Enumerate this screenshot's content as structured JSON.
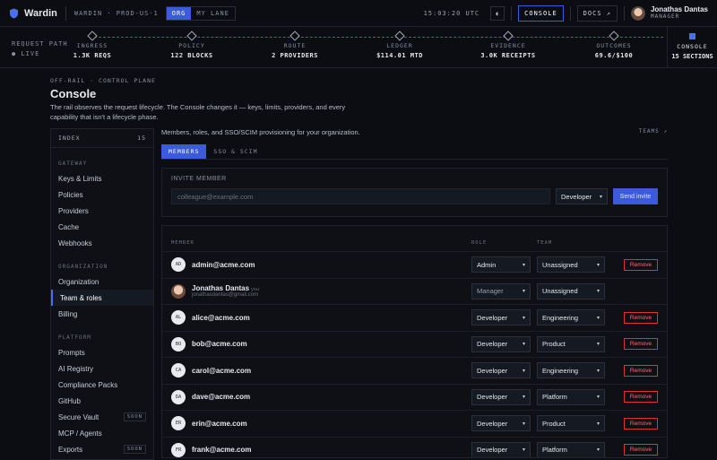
{
  "topbar": {
    "brand": "Wardin",
    "crumb": "WARDIN · PROD-US-1",
    "scope_tabs": [
      "ORG",
      "MY LANE"
    ],
    "time": "15:03:20 UTC",
    "console_label": "CONSOLE",
    "docs_label": "DOCS ↗",
    "user_name": "Jonathas Dantas",
    "user_role": "MANAGER"
  },
  "rail": {
    "label": "REQUEST PATH",
    "status": "● LIVE",
    "stages": [
      {
        "label": "INGRESS",
        "value": "1.3K REQS"
      },
      {
        "label": "POLICY",
        "value": "122 BLOCKS"
      },
      {
        "label": "ROUTE",
        "value": "2 PROVIDERS"
      },
      {
        "label": "LEDGER",
        "value": "$114.01 MTD"
      },
      {
        "label": "EVIDENCE",
        "value": "3.0K RECEIPTS"
      },
      {
        "label": "OUTCOMES",
        "value": "69.6/$100"
      }
    ],
    "console": {
      "label": "CONSOLE",
      "value": "15 SECTIONS"
    }
  },
  "intro": {
    "kicker": "OFF-RAIL · CONTROL PLANE",
    "title": "Console",
    "desc": "The rail observes the request lifecycle. The Console changes it — keys, limits, providers, and every capability that isn't a lifecycle phase."
  },
  "sidebar": {
    "index_label": "INDEX",
    "index_count": "15",
    "groups": [
      {
        "label": "GATEWAY"
      },
      {
        "label": "ORGANIZATION"
      },
      {
        "label": "PLATFORM"
      }
    ],
    "gateway": [
      "Keys & Limits",
      "Policies",
      "Providers",
      "Cache",
      "Webhooks"
    ],
    "organization": [
      "Organization",
      "Team & roles",
      "Billing"
    ],
    "platform": [
      "Prompts",
      "AI Registry",
      "Compliance Packs",
      "GitHub",
      "Secure Vault",
      "MCP / Agents",
      "Exports"
    ],
    "soon_label": "SOON"
  },
  "main": {
    "header": "Members, roles, and SSO/SCIM provisioning for your organization.",
    "teams_link": "TEAMS ↗",
    "tabs": [
      "MEMBERS",
      "SSO & SCIM"
    ],
    "invite": {
      "heading": "INVITE MEMBER",
      "placeholder": "colleague@example.com",
      "role": "Developer",
      "send": "Send invite"
    },
    "columns": {
      "member": "MEMBER",
      "role": "ROLE",
      "team": "TEAM"
    },
    "remove_label": "Remove",
    "you_label": "you",
    "members": [
      {
        "initials": "AD",
        "email": "admin@acme.com",
        "role": "Admin",
        "team": "Unassigned"
      },
      {
        "name": "Jonathas Dantas",
        "email": "jonathasdantas@gmail.com",
        "role": "Manager",
        "team": "Unassigned"
      },
      {
        "initials": "AL",
        "email": "alice@acme.com",
        "role": "Developer",
        "team": "Engineering"
      },
      {
        "initials": "BO",
        "email": "bob@acme.com",
        "role": "Developer",
        "team": "Product"
      },
      {
        "initials": "CA",
        "email": "carol@acme.com",
        "role": "Developer",
        "team": "Engineering"
      },
      {
        "initials": "DA",
        "email": "dave@acme.com",
        "role": "Developer",
        "team": "Platform"
      },
      {
        "initials": "ER",
        "email": "erin@acme.com",
        "role": "Developer",
        "team": "Product"
      },
      {
        "initials": "FR",
        "email": "frank@acme.com",
        "role": "Developer",
        "team": "Platform"
      }
    ]
  },
  "colors": {
    "accent": "#3b5bdb",
    "danger": "#e03131",
    "bg": "#0b0d12"
  }
}
